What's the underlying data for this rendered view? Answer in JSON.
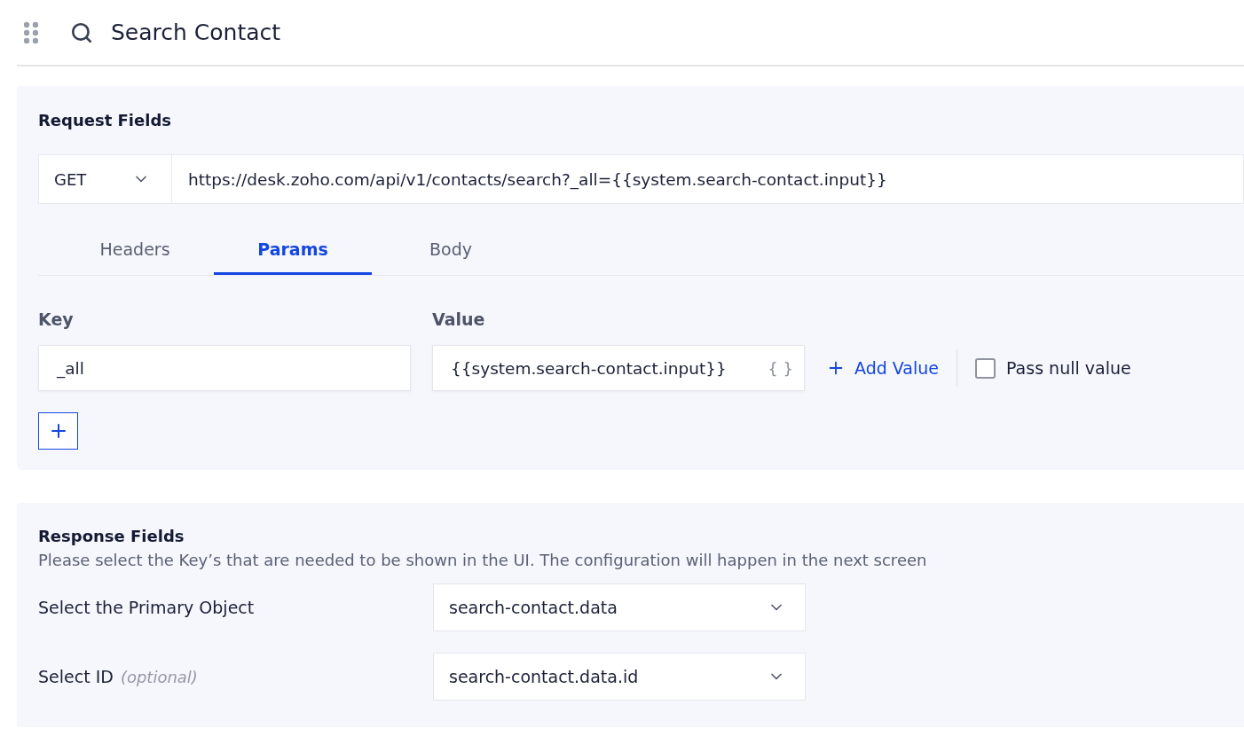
{
  "header": {
    "title": "Search Contact"
  },
  "request": {
    "title": "Request Fields",
    "method": "GET",
    "url": "https://desk.zoho.com/api/v1/contacts/search?_all={{system.search-contact.input}}",
    "tabs": [
      {
        "label": "Headers",
        "selected": false
      },
      {
        "label": "Params",
        "selected": true
      },
      {
        "label": "Body",
        "selected": false
      }
    ],
    "params": {
      "key_label": "Key",
      "value_label": "Value",
      "rows": [
        {
          "key": "_all",
          "value": "{{system.search-contact.input}}",
          "variable_glyph": "{ }",
          "add_value": "Add Value",
          "pass_null_label": "Pass null value",
          "pass_null": false
        }
      ]
    }
  },
  "response": {
    "title": "Response Fields",
    "description": "Please select the Key’s that are needed to be shown in the UI. The configuration will happen in the next screen",
    "fields": [
      {
        "label": "Select the Primary Object",
        "value": "search-contact.data"
      },
      {
        "label": "Select ID",
        "hint": "(optional)",
        "value": "search-contact.data.id"
      }
    ]
  }
}
